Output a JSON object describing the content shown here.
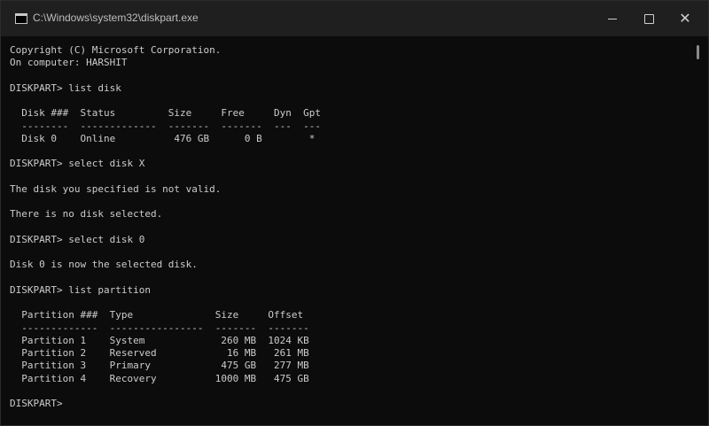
{
  "window": {
    "title": "C:\\Windows\\system32\\diskpart.exe",
    "minimize_glyph": "minimize",
    "maximize_glyph": "maximize",
    "close_glyph": "✕"
  },
  "terminal": {
    "lines": [
      "Copyright (C) Microsoft Corporation.",
      "On computer: HARSHIT",
      "",
      "DISKPART> list disk",
      "",
      "  Disk ###  Status         Size     Free     Dyn  Gpt",
      "  --------  -------------  -------  -------  ---  ---",
      "  Disk 0    Online          476 GB      0 B        *",
      "",
      "DISKPART> select disk X",
      "",
      "The disk you specified is not valid.",
      "",
      "There is no disk selected.",
      "",
      "DISKPART> select disk 0",
      "",
      "Disk 0 is now the selected disk.",
      "",
      "DISKPART> list partition",
      "",
      "  Partition ###  Type              Size     Offset",
      "  -------------  ----------------  -------  -------",
      "  Partition 1    System             260 MB  1024 KB",
      "  Partition 2    Reserved            16 MB   261 MB",
      "  Partition 3    Primary            475 GB   277 MB",
      "  Partition 4    Recovery          1000 MB   475 GB",
      "",
      "DISKPART> "
    ]
  }
}
